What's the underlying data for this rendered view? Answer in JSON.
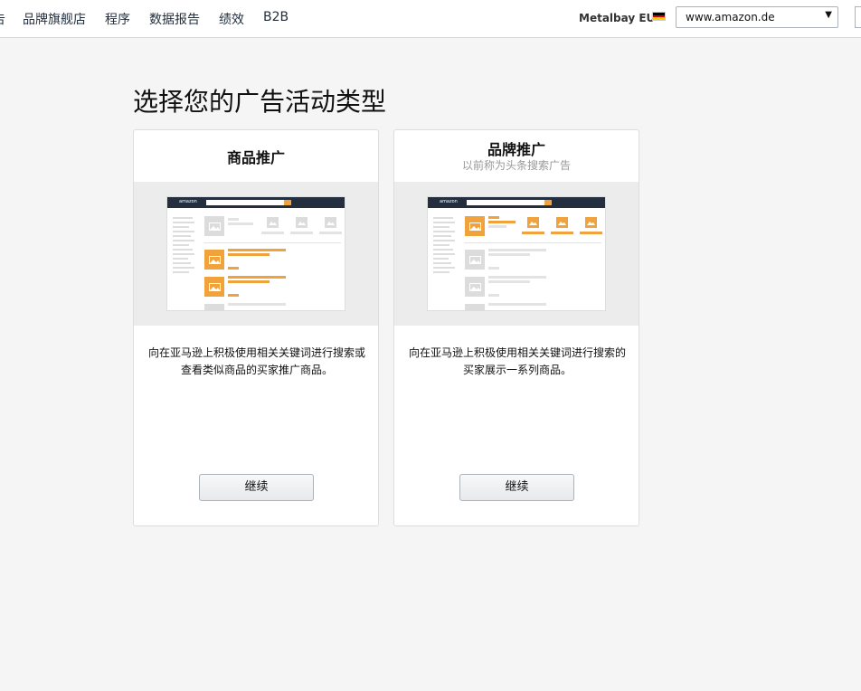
{
  "nav": {
    "partial_item": "告",
    "items": [
      "品牌旗舰店",
      "程序",
      "数据报告",
      "绩效",
      "B2B"
    ]
  },
  "account": {
    "name": "Metalbay EU",
    "flag": "germany-flag",
    "marketplace": "www.amazon.de"
  },
  "page_title": "选择您的广告活动类型",
  "cards": [
    {
      "title": "商品推广",
      "subtitle": "",
      "description": "向在亚马逊上积极使用相关关键词进行搜索或查看类似商品的买家推广商品。",
      "button": "继续"
    },
    {
      "title": "品牌推广",
      "subtitle": "以前称为头条搜索广告",
      "description": "向在亚马逊上积极使用相关关键词进行搜索的买家展示一系列商品。",
      "button": "继续"
    }
  ],
  "preview": {
    "logo_text": "amazon"
  },
  "colors": {
    "accent_orange": "#f0a33c",
    "header_dark": "#232f3e",
    "placeholder_gray": "#dcdcdc"
  }
}
